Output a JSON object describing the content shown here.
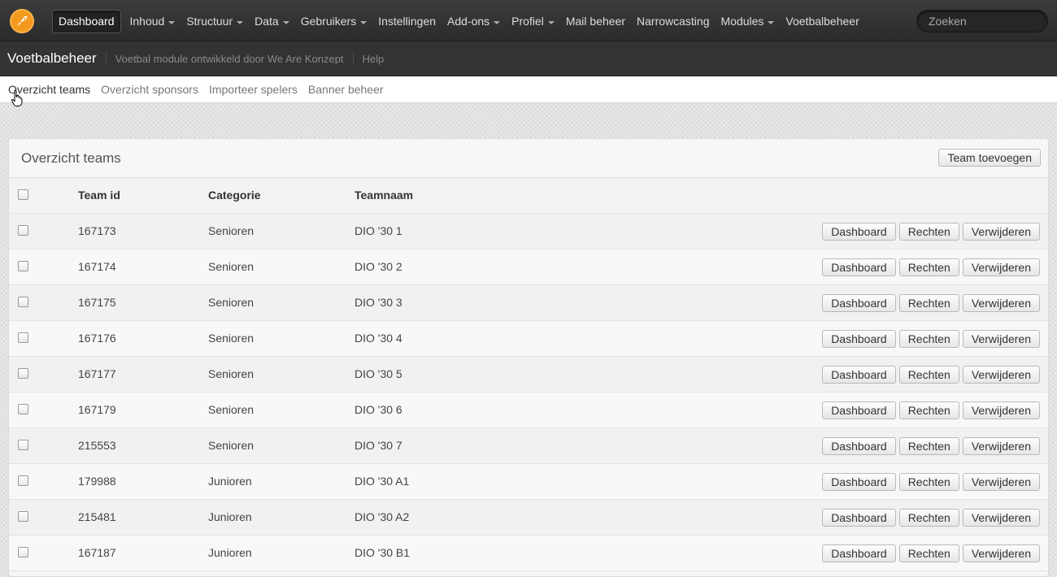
{
  "topbar": {
    "nav": [
      {
        "label": "Dashboard",
        "active": true,
        "caret": false,
        "name": "nav-dashboard"
      },
      {
        "label": "Inhoud",
        "caret": true,
        "name": "nav-inhoud"
      },
      {
        "label": "Structuur",
        "caret": true,
        "name": "nav-structuur"
      },
      {
        "label": "Data",
        "caret": true,
        "name": "nav-data"
      },
      {
        "label": "Gebruikers",
        "caret": true,
        "name": "nav-gebruikers"
      },
      {
        "label": "Instellingen",
        "caret": false,
        "name": "nav-instellingen"
      },
      {
        "label": "Add-ons",
        "caret": true,
        "name": "nav-add-ons"
      },
      {
        "label": "Profiel",
        "caret": true,
        "name": "nav-profiel"
      },
      {
        "label": "Mail beheer",
        "caret": false,
        "name": "nav-mail-beheer"
      },
      {
        "label": "Narrowcasting",
        "caret": false,
        "name": "nav-narrowcasting"
      },
      {
        "label": "Modules",
        "caret": true,
        "name": "nav-modules"
      },
      {
        "label": "Voetbalbeheer",
        "caret": false,
        "name": "nav-voetbalbeheer"
      }
    ],
    "search_placeholder": "Zoeken"
  },
  "subbar": {
    "title": "Voetbalbeheer",
    "description": "Voetbal module ontwikkeld door We Are Konzept",
    "help": "Help"
  },
  "tabs": [
    {
      "label": "Overzicht teams",
      "active": true,
      "name": "tab-overzicht-teams"
    },
    {
      "label": "Overzicht sponsors",
      "name": "tab-overzicht-sponsors"
    },
    {
      "label": "Importeer spelers",
      "name": "tab-importeer-spelers"
    },
    {
      "label": "Banner beheer",
      "name": "tab-banner-beheer"
    }
  ],
  "panel": {
    "title": "Overzicht teams",
    "add_button": "Team toevoegen",
    "columns": {
      "id": "Team id",
      "category": "Categorie",
      "name": "Teamnaam"
    },
    "actions": {
      "dashboard": "Dashboard",
      "rights": "Rechten",
      "delete": "Verwijderen"
    },
    "rows": [
      {
        "id": "167173",
        "category": "Senioren",
        "name": "DIO '30 1"
      },
      {
        "id": "167174",
        "category": "Senioren",
        "name": "DIO '30 2"
      },
      {
        "id": "167175",
        "category": "Senioren",
        "name": "DIO '30 3"
      },
      {
        "id": "167176",
        "category": "Senioren",
        "name": "DIO '30 4"
      },
      {
        "id": "167177",
        "category": "Senioren",
        "name": "DIO '30 5"
      },
      {
        "id": "167179",
        "category": "Senioren",
        "name": "DIO '30 6"
      },
      {
        "id": "215553",
        "category": "Senioren",
        "name": "DIO '30 7"
      },
      {
        "id": "179988",
        "category": "Junioren",
        "name": "DIO '30 A1"
      },
      {
        "id": "215481",
        "category": "Junioren",
        "name": "DIO '30 A2"
      },
      {
        "id": "167187",
        "category": "Junioren",
        "name": "DIO '30 B1"
      }
    ]
  },
  "colors": {
    "logo": "#f39a1e",
    "topbar": "#333333"
  }
}
